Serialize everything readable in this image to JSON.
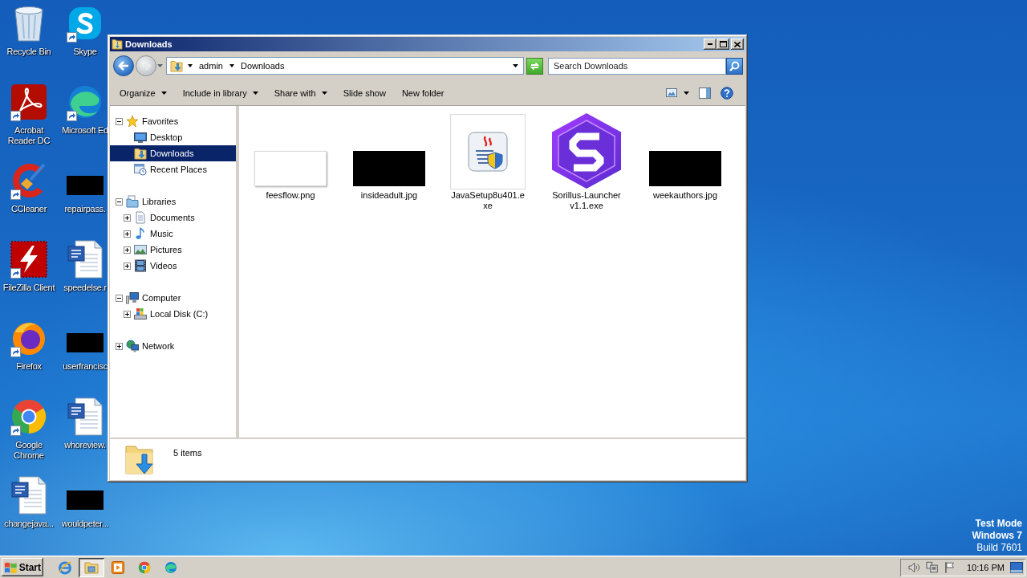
{
  "desktop": {
    "icons": [
      {
        "label": "Recycle Bin",
        "kind": "app",
        "shortcut": false
      },
      {
        "label": "Acrobat Reader DC",
        "kind": "app",
        "shortcut": true
      },
      {
        "label": "CCleaner",
        "kind": "app",
        "shortcut": true
      },
      {
        "label": "FileZilla Client",
        "kind": "app",
        "shortcut": true
      },
      {
        "label": "Firefox",
        "kind": "app",
        "shortcut": true
      },
      {
        "label": "Google Chrome",
        "kind": "app",
        "shortcut": true
      },
      {
        "label": "changejava...",
        "kind": "document",
        "shortcut": false
      },
      {
        "label": "Skype",
        "kind": "app",
        "shortcut": true
      },
      {
        "label": "Microsoft Ed",
        "kind": "app",
        "shortcut": true
      },
      {
        "label": "repairpass.",
        "kind": "image",
        "shortcut": false
      },
      {
        "label": "speedelse.r",
        "kind": "document",
        "shortcut": false
      },
      {
        "label": "userfrancisc",
        "kind": "image",
        "shortcut": false
      },
      {
        "label": "whoreview.",
        "kind": "document",
        "shortcut": false
      },
      {
        "label": "wouldpeter...",
        "kind": "image",
        "shortcut": false
      }
    ],
    "notice": [
      "Test Mode",
      "Windows 7",
      "Build 7601"
    ]
  },
  "window": {
    "title": "Downloads",
    "address": {
      "crumbs": [
        "admin",
        "Downloads"
      ]
    },
    "search": {
      "placeholder": "Search Downloads"
    },
    "toolbar": {
      "buttons": [
        {
          "label": "Organize",
          "menu": true
        },
        {
          "label": "Include in library",
          "menu": true
        },
        {
          "label": "Share with",
          "menu": true
        },
        {
          "label": "Slide show",
          "menu": false
        },
        {
          "label": "New folder",
          "menu": false
        }
      ]
    },
    "navigation": [
      {
        "label": "Favorites",
        "expanded": true,
        "selected": false,
        "children": [
          {
            "label": "Desktop",
            "selected": false
          },
          {
            "label": "Downloads",
            "selected": true
          },
          {
            "label": "Recent Places",
            "selected": false
          }
        ]
      },
      {
        "label": "Libraries",
        "expanded": true,
        "selected": false,
        "children": [
          {
            "label": "Documents",
            "expanded": false,
            "selected": false
          },
          {
            "label": "Music",
            "expanded": false,
            "selected": false
          },
          {
            "label": "Pictures",
            "expanded": false,
            "selected": false
          },
          {
            "label": "Videos",
            "expanded": false,
            "selected": false
          }
        ]
      },
      {
        "label": "Computer",
        "expanded": true,
        "selected": false,
        "children": [
          {
            "label": "Local Disk (C:)",
            "expanded": false,
            "selected": false
          }
        ]
      },
      {
        "label": "Network",
        "expanded": false,
        "selected": false
      }
    ],
    "files": [
      {
        "name": "feesflow.png",
        "kind": "image"
      },
      {
        "name": "insideadult.jpg",
        "kind": "image"
      },
      {
        "name": "JavaSetup8u401.exe",
        "kind": "program"
      },
      {
        "name": "Sorillus-Launcher v1.1.exe",
        "kind": "program"
      },
      {
        "name": "weekauthors.jpg",
        "kind": "image"
      }
    ],
    "details": {
      "count": "5 items"
    }
  },
  "taskbar": {
    "start": "Start",
    "items": [
      {
        "selected": false
      },
      {
        "selected": true
      },
      {
        "selected": false
      },
      {
        "selected": false
      },
      {
        "selected": false
      }
    ],
    "clock": "10:16 PM"
  }
}
